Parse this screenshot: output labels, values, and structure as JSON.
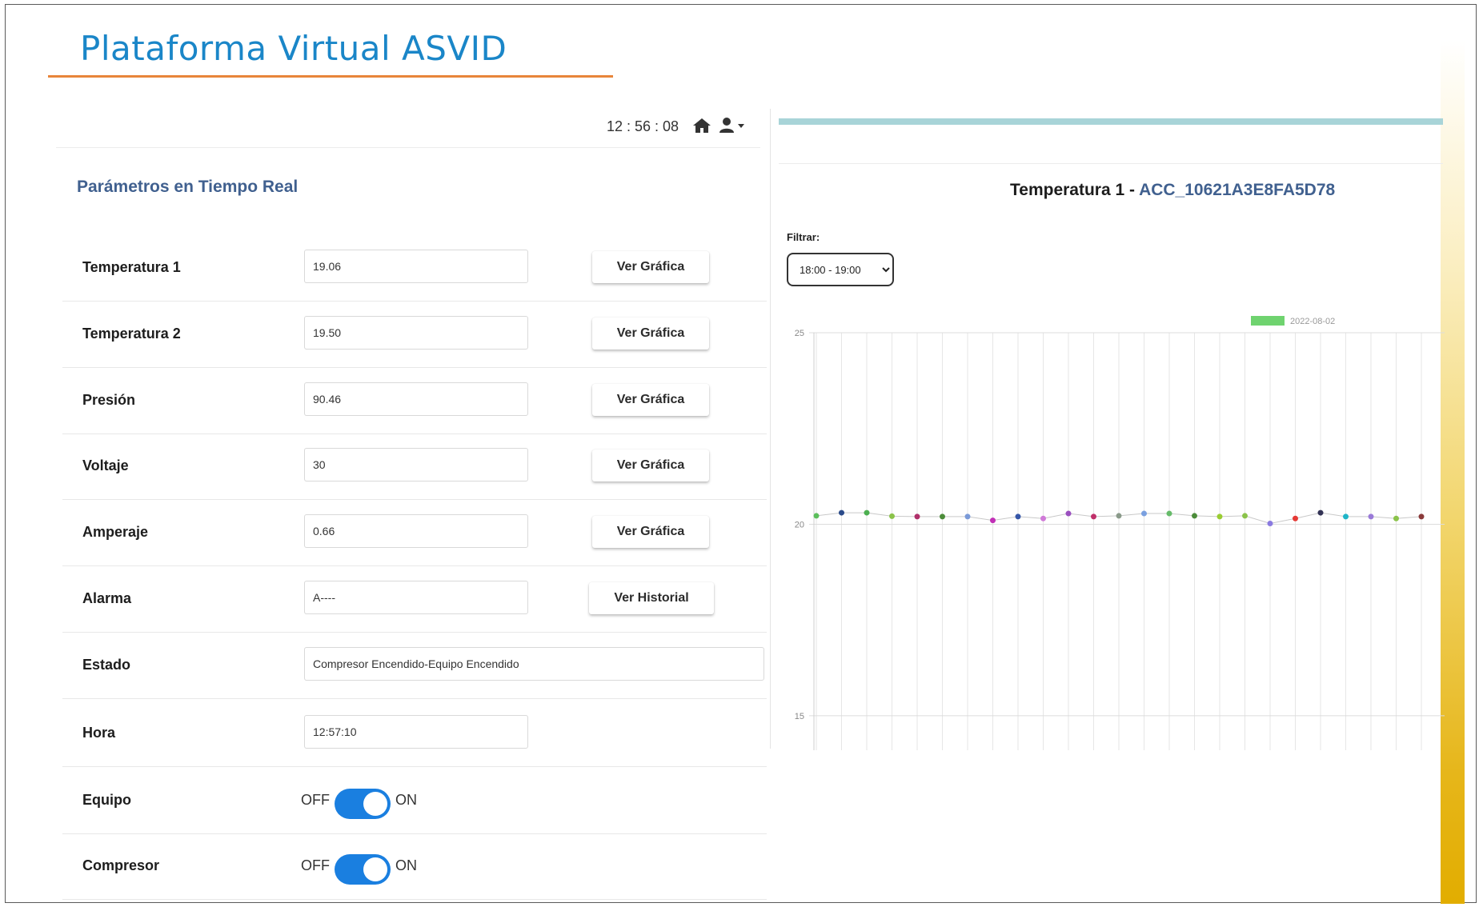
{
  "header": {
    "title": "Plataforma Virtual ASVID"
  },
  "topbar": {
    "clock": "12 : 56 : 08",
    "home_icon": "home-icon",
    "user_icon": "user-icon"
  },
  "section_title": "Parámetros en Tiempo Real",
  "rows": [
    {
      "label": "Temperatura 1",
      "value": "19.06",
      "button": "Ver Gráfica"
    },
    {
      "label": "Temperatura 2",
      "value": "19.50",
      "button": "Ver Gráfica"
    },
    {
      "label": "Presión",
      "value": "90.46",
      "button": "Ver Gráfica"
    },
    {
      "label": "Voltaje",
      "value": "30",
      "button": "Ver Gráfica"
    },
    {
      "label": "Amperaje",
      "value": "0.66",
      "button": "Ver Gráfica"
    },
    {
      "label": "Alarma",
      "value": "A----",
      "button": "Ver Historial"
    },
    {
      "label": "Estado",
      "value": "Compresor Encendido-Equipo Encendido"
    },
    {
      "label": "Hora",
      "value": "12:57:10"
    }
  ],
  "toggles": [
    {
      "label": "Equipo",
      "off": "OFF",
      "on": "ON",
      "state": "on"
    },
    {
      "label": "Compresor",
      "off": "OFF",
      "on": "ON",
      "state": "on"
    }
  ],
  "right_panel": {
    "chart_title_prefix": "Temperatura 1 - ",
    "chart_title_id": "ACC_10621A3E8FA5D78",
    "filter_label": "Filtrar:",
    "filter_options": [
      "18:00 - 19:00"
    ],
    "filter_selected": "18:00 - 19:00"
  },
  "colors": {
    "title": "#1a86c8",
    "accent_rule": "#e8853a",
    "toggle": "#1a7fe0",
    "legend": "#6fd36f",
    "heading": "#40608f"
  },
  "chart_data": {
    "type": "scatter",
    "title": "",
    "legend": [
      {
        "name": "2022-08-02",
        "color": "#6fd36f"
      }
    ],
    "yticks": [
      "25",
      "20",
      "15"
    ],
    "ylim": [
      14.1,
      25
    ],
    "grid": true,
    "series": [
      {
        "name": "2022-08-02",
        "values": [
          20.22,
          20.3,
          20.3,
          20.21,
          20.2,
          20.2,
          20.2,
          20.1,
          20.2,
          20.15,
          20.28,
          20.2,
          20.22,
          20.28,
          20.28,
          20.22,
          20.2,
          20.22,
          20.02,
          20.15,
          20.3,
          20.2,
          20.2,
          20.15,
          20.2
        ],
        "point_colors": [
          "#5cbf5c",
          "#2b4b8a",
          "#4caf50",
          "#8bc34a",
          "#b0306a",
          "#4c8c3a",
          "#7a9ad8",
          "#c12fb6",
          "#3556a8",
          "#d07ad8",
          "#9a4fbf",
          "#c0306a",
          "#8a9a8a",
          "#7aa0e0",
          "#66bb6a",
          "#4c8c3a",
          "#9acd32",
          "#8bc34a",
          "#8a7ae0",
          "#e53935",
          "#333355",
          "#1fb5c8",
          "#9a7ad8",
          "#8bc34a",
          "#8a3a3a"
        ]
      }
    ]
  }
}
